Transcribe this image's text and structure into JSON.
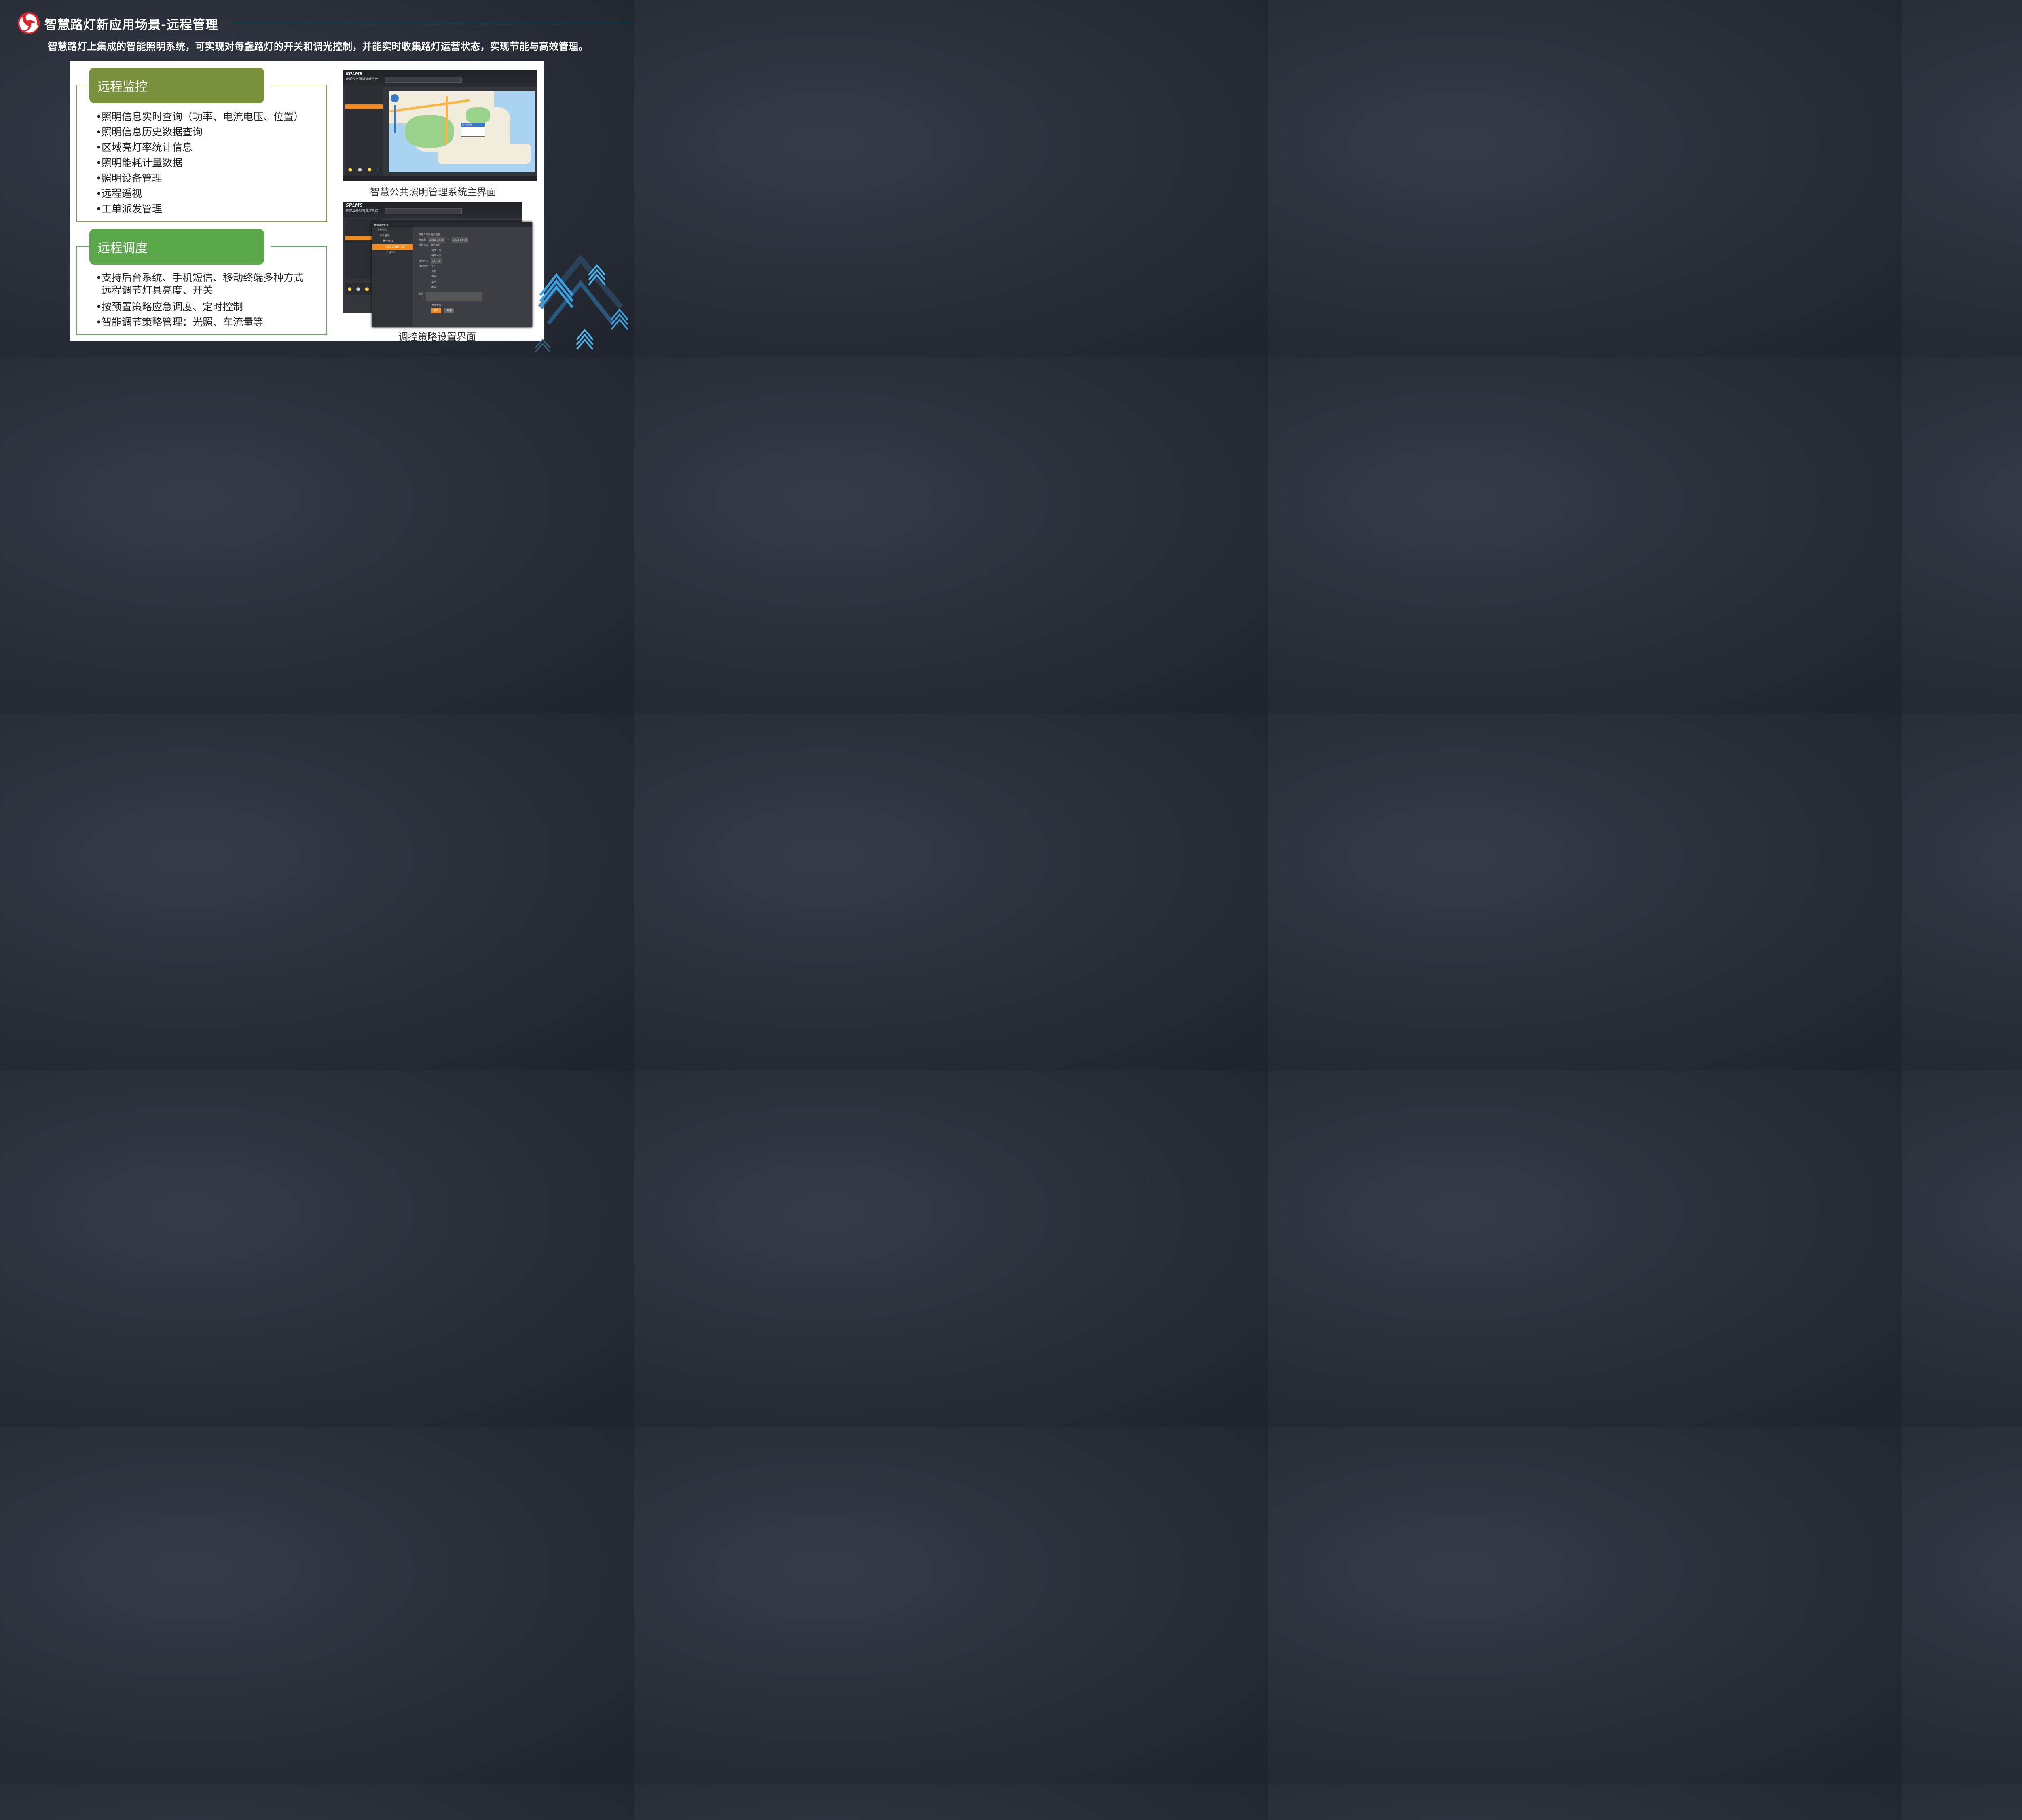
{
  "header": {
    "title": "智慧路灯新应用场景-远程管理",
    "subtitle": "智慧路灯上集成的智能照明系统，可实现对每盏路灯的开关和调光控制，并能实时收集路灯运营状态，实现节能与高效管理。"
  },
  "section1": {
    "heading": "远程监控",
    "items": [
      "照明信息实时查询（功率、电流电压、位置）",
      "照明信息历史数据查询",
      "区域亮灯率统计信息",
      "照明能耗计量数据",
      "照明设备管理",
      "远程遥视",
      "工单派发管理"
    ]
  },
  "section2": {
    "heading": "远程调度",
    "items": [
      "支持后台系统、手机短信、移动终端多种方式远程调节灯具亮度、开关",
      "按预置策略应急调度、定时控制",
      "智能调节策略管理：光照、车流量等"
    ]
  },
  "screens": {
    "main": {
      "brand": "SPLMS",
      "brand_sub": "智慧公共照明管理系统",
      "caption": "智慧公共照明管理系统主界面",
      "popup_title": "集中控制器"
    },
    "strategy": {
      "brand": "SPLMS",
      "brand_sub": "智慧公共照明管理系统",
      "caption": "调控策略设置界面",
      "dialog_title": "新增定时任务",
      "tree": [
        "监控中心",
        "演示区域",
        "集中器01",
        "CCD1010010007",
        "分组001"
      ],
      "form": {
        "prompt": "请输入定时任务信息",
        "date_label": "有效期",
        "date_from": "2013-03-08",
        "date_to": "2013-03-08",
        "mode_label": "执行模式",
        "modes": [
          "单次执行",
          "每天一次",
          "每周一次"
        ],
        "time_label": "执行时间",
        "time_value": "15 : 15",
        "cmd_label": "执行命令",
        "cmds": [
          "开灯",
          "关灯",
          "调光",
          "上电",
          "断电"
        ],
        "note_label": "备注",
        "send_now": "立即下发",
        "ok": "保存",
        "cancel": "取消"
      }
    }
  },
  "colors": {
    "background": "#2a2f38",
    "accent_line": "#5fb5bd",
    "header1": "#78923c",
    "header2": "#5aa84a",
    "selection": "#f08a22"
  }
}
